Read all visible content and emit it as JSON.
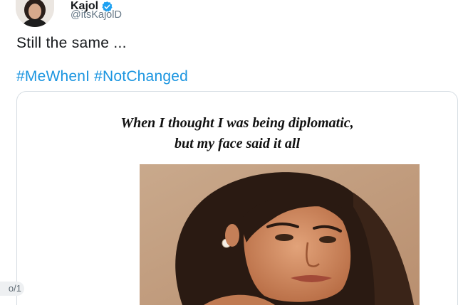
{
  "tweet": {
    "display_name": "Kajol",
    "handle": "@itsKajolD",
    "text": "Still the same ...",
    "hashtags": [
      "#MeWhenI",
      "#NotChanged"
    ],
    "verified": true
  },
  "card": {
    "caption_line1": "When I thought I was being diplomatic,",
    "caption_line2": "but my face said it all"
  },
  "overlay": {
    "page_indicator": "o/1"
  },
  "colors": {
    "link": "#1b95e0",
    "verified": "#1da1f2",
    "text": "#14171a",
    "muted": "#657786"
  }
}
